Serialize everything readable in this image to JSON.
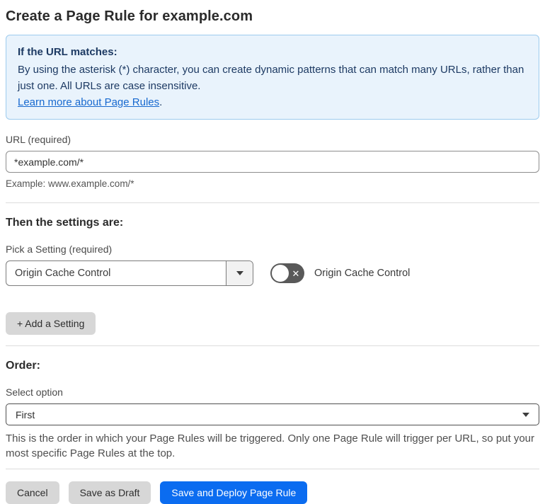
{
  "page": {
    "title": "Create a Page Rule for example.com"
  },
  "info_box": {
    "heading": "If the URL matches:",
    "body": "By using the asterisk (*) character, you can create dynamic patterns that can match many URLs, rather than just one. All URLs are case insensitive.",
    "link": "Learn more about Page Rules",
    "link_suffix": "."
  },
  "url_field": {
    "label": "URL (required)",
    "value": "*example.com/*",
    "example": "Example: www.example.com/*"
  },
  "settings": {
    "heading": "Then the settings are:",
    "picker_label": "Pick a Setting (required)",
    "picker_value": "Origin Cache Control",
    "toggle_label": "Origin Cache Control",
    "toggle_state": "off",
    "toggle_x": "✕",
    "add_button": "+ Add a Setting"
  },
  "order": {
    "heading": "Order:",
    "label": "Select option",
    "value": "First",
    "help": "This is the order in which your Page Rules will be triggered. Only one Page Rule will trigger per URL, so put your most specific Page Rules at the top."
  },
  "actions": {
    "cancel": "Cancel",
    "save_draft": "Save as Draft",
    "save_deploy": "Save and Deploy Page Rule"
  },
  "colors": {
    "primary_blue": "#0b6cf0",
    "info_bg": "#e9f3fc",
    "info_border": "#9dcbee",
    "info_text": "#1d3a63",
    "link_blue": "#1769cf",
    "toggle_bg": "#595959",
    "gray_button": "#d7d7d7"
  }
}
